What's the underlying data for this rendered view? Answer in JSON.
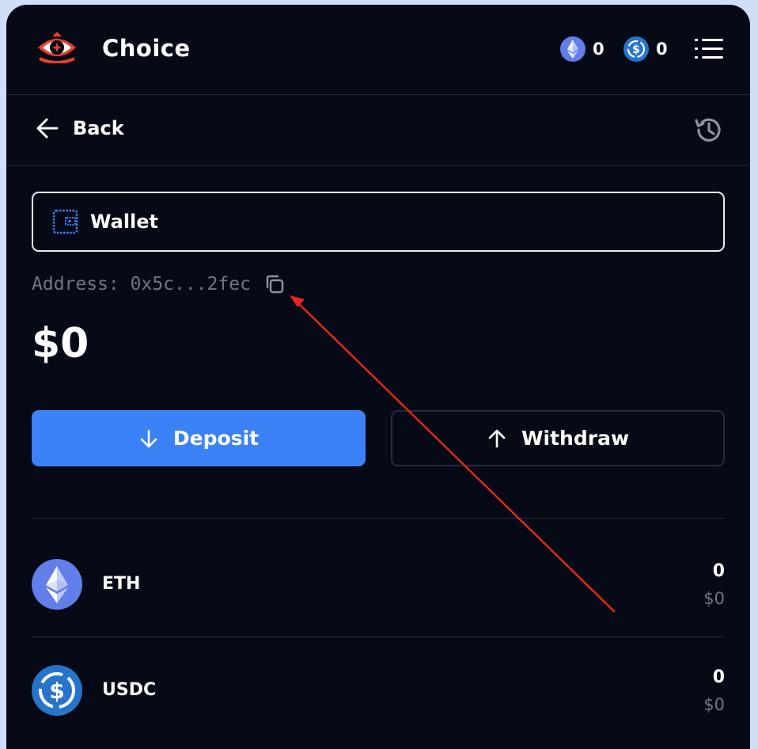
{
  "header": {
    "brand": "Choice",
    "logo_icon": "eye-logo-icon",
    "balances": [
      {
        "coin": "ETH",
        "icon": "eth-coin-icon",
        "value": "0"
      },
      {
        "coin": "USDC",
        "icon": "usdc-coin-icon",
        "value": "0"
      }
    ],
    "menu_icon": "menu-list-icon"
  },
  "subbar": {
    "back_label": "Back",
    "history_icon": "history-icon"
  },
  "wallet": {
    "label": "Wallet",
    "icon": "wallet-icon",
    "address": "Address: 0x5c...2fec",
    "copy_icon": "copy-icon",
    "total": "$0"
  },
  "actions": {
    "deposit_label": "Deposit",
    "withdraw_label": "Withdraw"
  },
  "assets": [
    {
      "name": "ETH",
      "amount": "0",
      "usd": "$0"
    },
    {
      "name": "USDC",
      "amount": "0",
      "usd": "$0"
    }
  ],
  "colors": {
    "background": "#050a16",
    "accent": "#3b82f6",
    "muted_text": "#6e7687",
    "logo_red": "#e8402f",
    "annotation_arrow": "#e5261b"
  }
}
